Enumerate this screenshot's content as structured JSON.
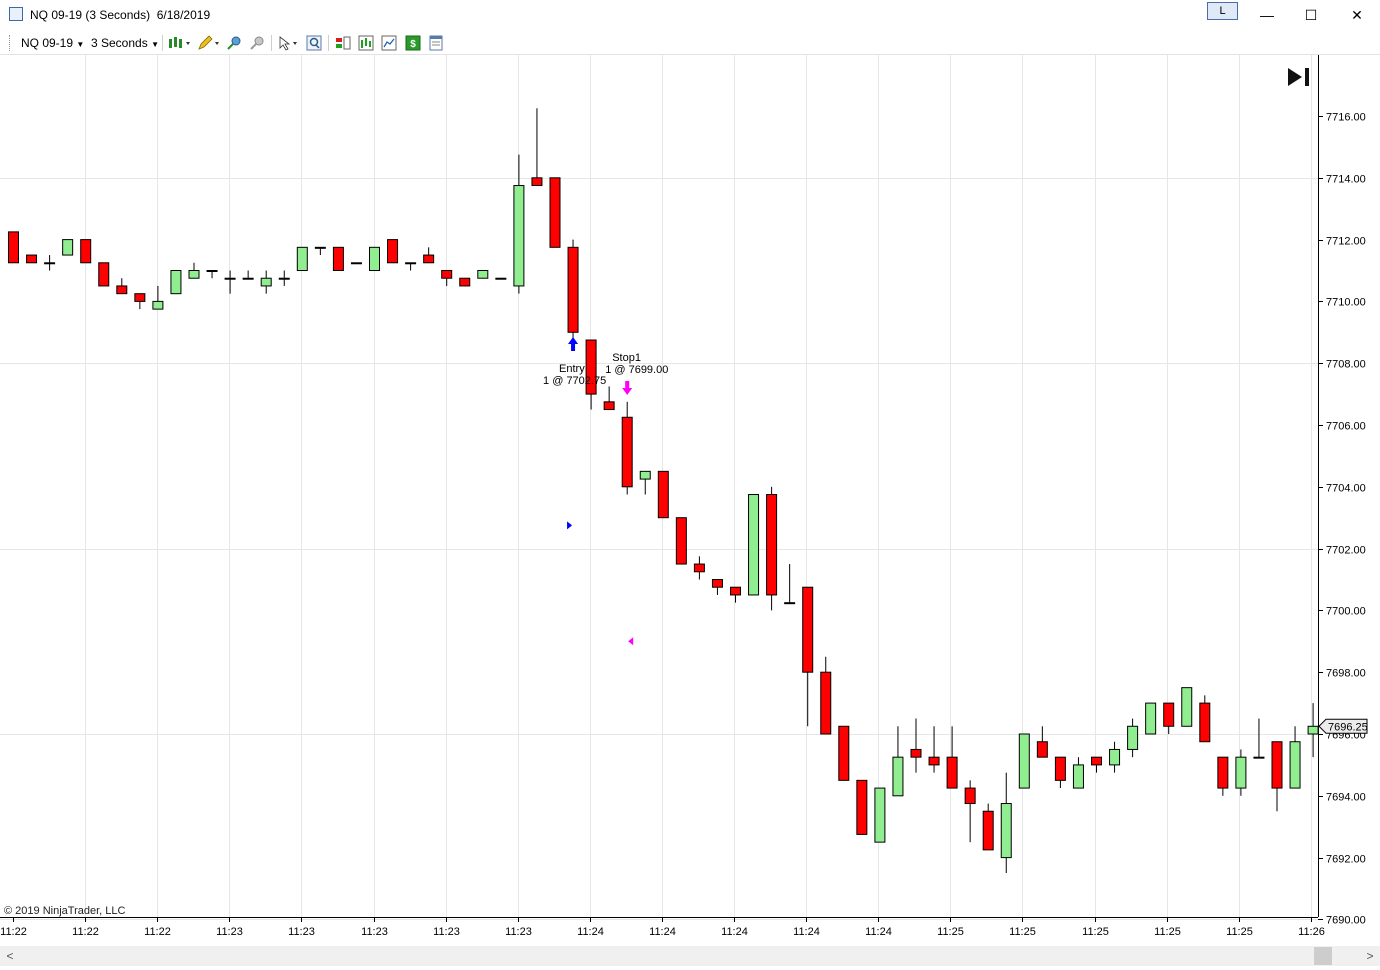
{
  "window": {
    "title": "NQ 09-19 (3 Seconds)  6/18/2019",
    "l_badge": "L",
    "minimize": "—",
    "maximize": "☐",
    "close": "✕"
  },
  "toolbar": {
    "instrument": "NQ 09-19",
    "interval": "3 Seconds",
    "icons": [
      "bar-style-icon",
      "drawing-tool-icon",
      "zoom-in-icon",
      "zoom-out-icon",
      "pointer-icon",
      "magnifier-icon",
      "strategies-icon",
      "indicators-icon",
      "chart-trader-icon",
      "dollar-icon",
      "properties-icon"
    ]
  },
  "footer": {
    "copyright": "© 2019 NinjaTrader, LLC"
  },
  "colors": {
    "up": "#90ee90",
    "down": "#ff0000",
    "wick": "#000000",
    "grid": "#e6e6e6",
    "entry_arrow": "#0000ff",
    "stop_arrow": "#ff00ff",
    "price_marker_bg": "#ececec"
  },
  "chart_data": {
    "type": "candlestick",
    "instrument": "NQ 09-19",
    "interval": "3 Seconds",
    "ylim": [
      7690.0,
      7717.5
    ],
    "yticks": [
      "7716.00",
      "7714.00",
      "7712.00",
      "7710.00",
      "7708.00",
      "7706.00",
      "7704.00",
      "7702.00",
      "7700.00",
      "7698.00",
      "7696.00",
      "7694.00",
      "7692.00",
      "7690.00"
    ],
    "xticks": [
      "11:22",
      "11:22",
      "11:22",
      "11:23",
      "11:23",
      "11:23",
      "11:23",
      "11:23",
      "11:24",
      "11:24",
      "11:24",
      "11:24",
      "11:24",
      "11:25",
      "11:25",
      "11:25",
      "11:25",
      "11:25",
      "11:26"
    ],
    "last_price": "7696.25",
    "candles": [
      {
        "o": 7712.25,
        "h": 7712.25,
        "l": 7711.25,
        "c": 7711.25
      },
      {
        "o": 7711.5,
        "h": 7711.5,
        "l": 7711.25,
        "c": 7711.25
      },
      {
        "o": 7711.25,
        "h": 7711.5,
        "l": 7711.0,
        "c": 7711.25
      },
      {
        "o": 7711.5,
        "h": 7712.0,
        "l": 7711.5,
        "c": 7712.0
      },
      {
        "o": 7712.0,
        "h": 7712.0,
        "l": 7711.25,
        "c": 7711.25
      },
      {
        "o": 7711.25,
        "h": 7711.25,
        "l": 7710.5,
        "c": 7710.5
      },
      {
        "o": 7710.5,
        "h": 7710.75,
        "l": 7710.25,
        "c": 7710.25
      },
      {
        "o": 7710.25,
        "h": 7710.25,
        "l": 7709.75,
        "c": 7710.0
      },
      {
        "o": 7709.75,
        "h": 7710.5,
        "l": 7709.75,
        "c": 7710.0
      },
      {
        "o": 7710.25,
        "h": 7711.0,
        "l": 7710.25,
        "c": 7711.0
      },
      {
        "o": 7710.75,
        "h": 7711.25,
        "l": 7710.75,
        "c": 7711.0
      },
      {
        "o": 7711.0,
        "h": 7711.0,
        "l": 7710.75,
        "c": 7711.0
      },
      {
        "o": 7710.75,
        "h": 7711.0,
        "l": 7710.25,
        "c": 7710.75
      },
      {
        "o": 7710.75,
        "h": 7711.0,
        "l": 7710.75,
        "c": 7710.75
      },
      {
        "o": 7710.5,
        "h": 7711.0,
        "l": 7710.25,
        "c": 7710.75
      },
      {
        "o": 7710.75,
        "h": 7711.0,
        "l": 7710.5,
        "c": 7710.75
      },
      {
        "o": 7711.0,
        "h": 7711.75,
        "l": 7711.0,
        "c": 7711.75
      },
      {
        "o": 7711.75,
        "h": 7711.75,
        "l": 7711.5,
        "c": 7711.75
      },
      {
        "o": 7711.75,
        "h": 7711.75,
        "l": 7711.0,
        "c": 7711.0
      },
      {
        "o": 7711.25,
        "h": 7711.25,
        "l": 7711.25,
        "c": 7711.25
      },
      {
        "o": 7711.0,
        "h": 7711.75,
        "l": 7711.0,
        "c": 7711.75
      },
      {
        "o": 7712.0,
        "h": 7712.0,
        "l": 7711.25,
        "c": 7711.25
      },
      {
        "o": 7711.25,
        "h": 7711.25,
        "l": 7711.0,
        "c": 7711.25
      },
      {
        "o": 7711.5,
        "h": 7711.75,
        "l": 7711.25,
        "c": 7711.25
      },
      {
        "o": 7711.0,
        "h": 7711.0,
        "l": 7710.5,
        "c": 7710.75
      },
      {
        "o": 7710.75,
        "h": 7710.75,
        "l": 7710.5,
        "c": 7710.5
      },
      {
        "o": 7710.75,
        "h": 7711.0,
        "l": 7710.75,
        "c": 7711.0
      },
      {
        "o": 7710.75,
        "h": 7710.75,
        "l": 7710.75,
        "c": 7710.75
      },
      {
        "o": 7710.5,
        "h": 7714.75,
        "l": 7710.25,
        "c": 7713.75
      },
      {
        "o": 7714.0,
        "h": 7716.25,
        "l": 7713.75,
        "c": 7713.75
      },
      {
        "o": 7714.0,
        "h": 7714.0,
        "l": 7711.75,
        "c": 7711.75
      },
      {
        "o": 7711.75,
        "h": 7712.0,
        "l": 7708.75,
        "c": 7709.0
      },
      {
        "o": 7708.75,
        "h": 7708.75,
        "l": 7706.5,
        "c": 7707.0
      },
      {
        "o": 7706.75,
        "h": 7707.25,
        "l": 7706.5,
        "c": 7706.5
      },
      {
        "o": 7706.25,
        "h": 7706.75,
        "l": 7703.75,
        "c": 7704.0
      },
      {
        "o": 7704.25,
        "h": 7704.5,
        "l": 7703.75,
        "c": 7704.5
      },
      {
        "o": 7704.5,
        "h": 7704.5,
        "l": 7703.0,
        "c": 7703.0
      },
      {
        "o": 7703.0,
        "h": 7703.0,
        "l": 7701.5,
        "c": 7701.5
      },
      {
        "o": 7701.5,
        "h": 7701.75,
        "l": 7701.0,
        "c": 7701.25
      },
      {
        "o": 7701.0,
        "h": 7701.0,
        "l": 7700.5,
        "c": 7700.75
      },
      {
        "o": 7700.75,
        "h": 7700.75,
        "l": 7700.25,
        "c": 7700.5
      },
      {
        "o": 7700.5,
        "h": 7703.75,
        "l": 7700.5,
        "c": 7703.75
      },
      {
        "o": 7703.75,
        "h": 7704.0,
        "l": 7700.0,
        "c": 7700.5
      },
      {
        "o": 7700.25,
        "h": 7701.5,
        "l": 7700.25,
        "c": 7700.25
      },
      {
        "o": 7700.75,
        "h": 7700.75,
        "l": 7696.25,
        "c": 7698.0
      },
      {
        "o": 7698.0,
        "h": 7698.5,
        "l": 7696.0,
        "c": 7696.0
      },
      {
        "o": 7696.25,
        "h": 7696.25,
        "l": 7694.5,
        "c": 7694.5
      },
      {
        "o": 7694.5,
        "h": 7694.5,
        "l": 7692.75,
        "c": 7692.75
      },
      {
        "o": 7692.5,
        "h": 7694.25,
        "l": 7692.5,
        "c": 7694.25
      },
      {
        "o": 7694.0,
        "h": 7696.25,
        "l": 7694.0,
        "c": 7695.25
      },
      {
        "o": 7695.5,
        "h": 7696.5,
        "l": 7694.75,
        "c": 7695.25
      },
      {
        "o": 7695.25,
        "h": 7696.25,
        "l": 7694.75,
        "c": 7695.0
      },
      {
        "o": 7695.25,
        "h": 7696.25,
        "l": 7694.25,
        "c": 7694.25
      },
      {
        "o": 7694.25,
        "h": 7694.5,
        "l": 7692.5,
        "c": 7693.75
      },
      {
        "o": 7693.5,
        "h": 7693.75,
        "l": 7692.25,
        "c": 7692.25
      },
      {
        "o": 7692.0,
        "h": 7694.75,
        "l": 7691.5,
        "c": 7693.75
      },
      {
        "o": 7694.25,
        "h": 7696.0,
        "l": 7694.25,
        "c": 7696.0
      },
      {
        "o": 7695.75,
        "h": 7696.25,
        "l": 7695.25,
        "c": 7695.25
      },
      {
        "o": 7695.25,
        "h": 7695.25,
        "l": 7694.25,
        "c": 7694.5
      },
      {
        "o": 7694.25,
        "h": 7695.25,
        "l": 7694.25,
        "c": 7695.0
      },
      {
        "o": 7695.25,
        "h": 7695.25,
        "l": 7694.75,
        "c": 7695.0
      },
      {
        "o": 7695.0,
        "h": 7695.75,
        "l": 7694.75,
        "c": 7695.5
      },
      {
        "o": 7695.5,
        "h": 7696.5,
        "l": 7695.25,
        "c": 7696.25
      },
      {
        "o": 7696.0,
        "h": 7697.0,
        "l": 7696.0,
        "c": 7697.0
      },
      {
        "o": 7697.0,
        "h": 7697.0,
        "l": 7696.0,
        "c": 7696.25
      },
      {
        "o": 7696.25,
        "h": 7697.5,
        "l": 7696.25,
        "c": 7697.5
      },
      {
        "o": 7697.0,
        "h": 7697.25,
        "l": 7695.75,
        "c": 7695.75
      },
      {
        "o": 7695.25,
        "h": 7695.25,
        "l": 7694.0,
        "c": 7694.25
      },
      {
        "o": 7694.25,
        "h": 7695.5,
        "l": 7694.0,
        "c": 7695.25
      },
      {
        "o": 7695.25,
        "h": 7696.5,
        "l": 7695.25,
        "c": 7695.25
      },
      {
        "o": 7695.75,
        "h": 7695.75,
        "l": 7693.5,
        "c": 7694.25
      },
      {
        "o": 7694.25,
        "h": 7696.25,
        "l": 7694.25,
        "c": 7695.75
      },
      {
        "o": 7696.0,
        "h": 7697.0,
        "l": 7695.25,
        "c": 7696.25
      }
    ],
    "executions": [
      {
        "name": "entry",
        "label_top": "Entry",
        "label_bottom": "1 @ 7702.75",
        "bar": 31,
        "price": 7702.75,
        "color": "#0000ff"
      },
      {
        "name": "stop",
        "label_top": "Stop1",
        "label_bottom": "1 @ 7699.00",
        "bar": 34,
        "price": 7699.0,
        "color": "#ff00ff"
      }
    ]
  }
}
